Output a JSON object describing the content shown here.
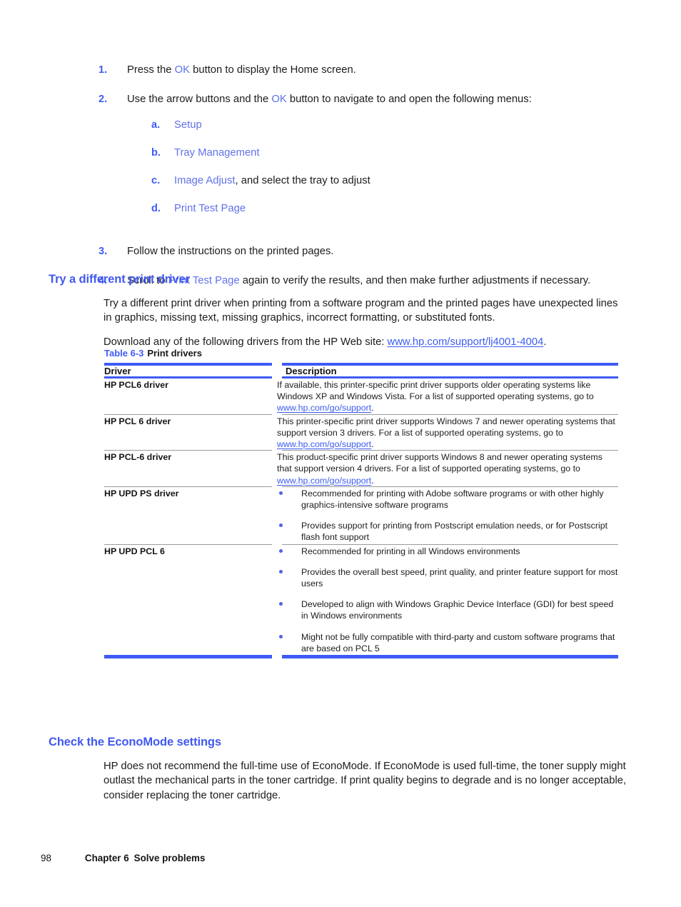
{
  "steps": [
    {
      "num": "1.",
      "parts": [
        {
          "t": "Press the ",
          "k": "plain"
        },
        {
          "t": "OK",
          "k": "ui"
        },
        {
          "t": " button to display the Home screen.",
          "k": "plain"
        }
      ],
      "text": "Press the OK button to display the Home screen."
    },
    {
      "num": "2.",
      "text": "Use the arrow buttons and the OK button to navigate to and open the following menus:",
      "substeps": [
        {
          "letter": "a.",
          "menu": "Setup",
          "tail": ""
        },
        {
          "letter": "b.",
          "menu": "Tray Management",
          "tail": ""
        },
        {
          "letter": "c.",
          "menu": "Image Adjust",
          "tail": ", and select the tray to adjust"
        },
        {
          "letter": "d.",
          "menu": "Print Test Page",
          "tail": ""
        }
      ]
    },
    {
      "num": "3.",
      "text": "Follow the instructions on the printed pages."
    },
    {
      "num": "4.",
      "text": "Scroll to Print Test Page again to verify the results, and then make further adjustments if necessary."
    }
  ],
  "step1": {
    "lead": "Press the ",
    "ui": "OK",
    "tail": " button to display the Home screen."
  },
  "step2": {
    "lead": "Use the arrow buttons and the ",
    "ui": "OK",
    "tail": " button to navigate to and open the following menus:"
  },
  "step3": {
    "text": "Follow the instructions on the printed pages."
  },
  "step4": {
    "lead": "Scroll to ",
    "menu": "Print Test Page",
    "tail": " again to verify the results, and then make further adjustments if necessary."
  },
  "driver_section": {
    "heading": "Try a different print driver",
    "paragraph_1": "Try a different print driver when printing from a software program and the printed pages have unexpected lines in graphics, missing text, missing graphics, incorrect formatting, or substituted fonts.",
    "paragraph_2_lead": "Download any of the following drivers from the HP Web site: ",
    "paragraph_2_link": "www.hp.com/support/lj4001-4004",
    "paragraph_2_tail": "."
  },
  "table": {
    "caption_label": "Table 6-3",
    "caption_title": "Print drivers",
    "columns": [
      "Driver",
      "Description"
    ],
    "rows": [
      {
        "driver": "HP PCL6 driver",
        "desc_lead": "If available, this printer-specific print driver supports older operating systems like Windows XP and Windows Vista. For a list of supported operating systems, go to ",
        "desc_link": "www.hp.com/go/support",
        "desc_tail": "."
      },
      {
        "driver": "HP PCL 6 driver",
        "desc_lead": "This printer-specific print driver supports Windows 7 and newer operating systems that support version 3 drivers. For a list of supported operating systems, go to ",
        "desc_link": "www.hp.com/go/support",
        "desc_tail": "."
      },
      {
        "driver": "HP PCL-6 driver",
        "desc_lead": "This product-specific print driver supports Windows 8 and newer operating systems that support version 4 drivers. For a list of supported operating systems, go to ",
        "desc_link": "www.hp.com/go/support",
        "desc_tail": "."
      },
      {
        "driver": "HP UPD PS driver",
        "bullets": [
          "Recommended for printing with Adobe software programs or with other highly graphics-intensive software programs",
          "Provides support for printing from Postscript emulation needs, or for Postscript flash font support"
        ]
      },
      {
        "driver": "HP UPD PCL 6",
        "bullets": [
          "Recommended for printing in all Windows environments",
          "Provides the overall best speed, print quality, and printer feature support for most users",
          "Developed to align with Windows Graphic Device Interface (GDI) for best speed in Windows environments",
          "Might not be fully compatible with third-party and custom software programs that are based on PCL 5"
        ]
      }
    ]
  },
  "econo_section": {
    "heading": "Check the EconoMode settings",
    "paragraph": "HP does not recommend the full-time use of EconoMode. If EconoMode is used full-time, the toner supply might outlast the mechanical parts in the toner cartridge. If print quality begins to degrade and is no longer acceptable, consider replacing the toner cartridge."
  },
  "footer": {
    "page_number": "98",
    "chapter": "Chapter 6",
    "chapter_title": "Solve problems"
  },
  "colors": {
    "accent_blue": "#3d5bf5",
    "heading_blue": "#4159f0",
    "ui_blue": "#5b6fe8",
    "link_blue": "#3b5cf0",
    "bullet_blue": "#4a63e8",
    "rule_gray": "#9a9a9a",
    "body_text": "#1c1c1c"
  }
}
